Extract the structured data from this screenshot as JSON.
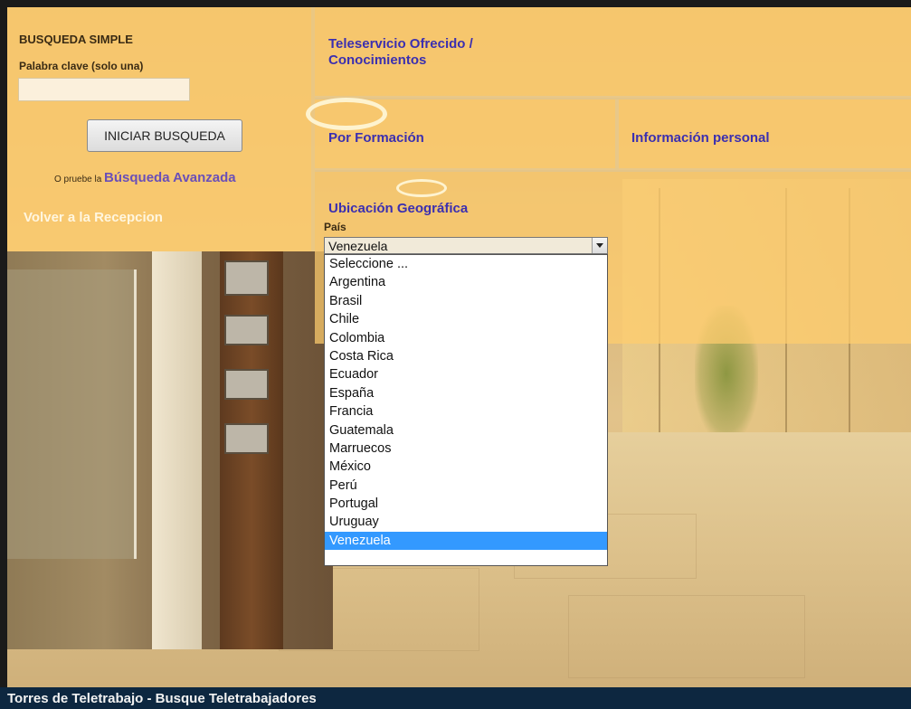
{
  "simple_search": {
    "title": "BUSQUEDA SIMPLE",
    "keyword_label": "Palabra clave (solo una)",
    "keyword_value": "",
    "search_button": "INICIAR BUSQUEDA",
    "try_prefix": "O pruebe la",
    "advanced_link": "Búsqueda Avanzada",
    "back_link": "Volver a la Recepcion"
  },
  "sections": {
    "teleservicio": "Teleservicio Ofrecido / Conocimientos",
    "formacion": "Por Formación",
    "personal": "Información personal",
    "geo": "Ubicación Geográfica"
  },
  "country": {
    "label": "País",
    "selected": "Venezuela",
    "options": [
      "Seleccione ...",
      "Argentina",
      "Brasil",
      "Chile",
      "Colombia",
      "Costa Rica",
      "Ecuador",
      "España",
      "Francia",
      "Guatemala",
      "Marruecos",
      "México",
      "Perú",
      "Portugal",
      "Uruguay",
      "Venezuela"
    ]
  },
  "status_bar": {
    "text": "Torres de Teletrabajo - Busque Teletrabajadores"
  },
  "colors": {
    "link": "#3b2fb0",
    "advanced_link": "#6a4fb8",
    "selection": "#3399ff",
    "status_bar": "#0d2740"
  }
}
